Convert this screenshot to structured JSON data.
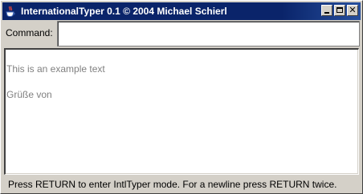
{
  "window": {
    "title": "InternationalTyper 0.1 © 2004 Michael Schierl",
    "icon": "java-coffee-cup-icon",
    "buttons": [
      "minimize-icon",
      "maximize-icon",
      "close-icon"
    ],
    "close_glyph": "✕"
  },
  "command": {
    "label": "Command:",
    "value": ""
  },
  "text_area": {
    "lines": [
      "This is an example text",
      "",
      "Grüße von"
    ]
  },
  "status": {
    "text": "Press RETURN to enter IntlTyper mode. For a newline press RETURN twice."
  },
  "colors": {
    "title_bar": "#0a246a",
    "window_bg": "#d4d0c8",
    "text_gray": "#808080"
  }
}
